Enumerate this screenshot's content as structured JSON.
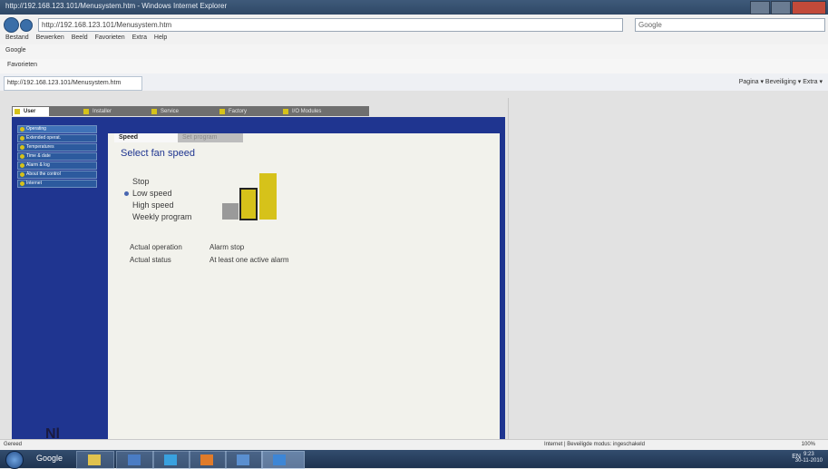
{
  "browser": {
    "window_title": "http://192.168.123.101/Menusystem.htm - Windows Internet Explorer",
    "address": "http://192.168.123.101/Menusystem.htm",
    "search_placeholder": "Google",
    "menu": [
      "Bestand",
      "Bewerken",
      "Beeld",
      "Favorieten",
      "Extra",
      "Help"
    ],
    "google_bar": "Google",
    "favorites_bar": "Favorieten",
    "page_tab": "http://192.168.123.101/Menusystem.htm",
    "page_tools": "Pagina ▾  Beveiliging ▾  Extra ▾",
    "status_left": "Gereed",
    "status_mid": "Internet | Beveiligde modus: ingeschakeld",
    "status_zoom": "100%"
  },
  "app": {
    "tabs": [
      {
        "label": "User",
        "active": true
      },
      {
        "label": "Installer",
        "active": false
      },
      {
        "label": "Service",
        "active": false
      },
      {
        "label": "Factory",
        "active": false
      },
      {
        "label": "I/O Modules",
        "active": false
      }
    ],
    "sidebar": [
      {
        "label": "Operating",
        "active": true
      },
      {
        "label": "Extended operat.",
        "active": false
      },
      {
        "label": "Temperatures",
        "active": false
      },
      {
        "label": "Time & date",
        "active": false
      },
      {
        "label": "Alarm & log",
        "active": false
      },
      {
        "label": "About the control",
        "active": false
      },
      {
        "label": "Internet",
        "active": false
      }
    ],
    "logo": "Nl",
    "panel_tabs": {
      "speed": "Speed",
      "schedule": "Set program"
    },
    "heading": "Select fan speed",
    "fan_options": [
      {
        "label": "Stop",
        "selected": false
      },
      {
        "label": "Low speed",
        "selected": true
      },
      {
        "label": "High speed",
        "selected": false
      },
      {
        "label": "Weekly program",
        "selected": false
      }
    ],
    "fan_level_active": 2,
    "actual_operation_label": "Actual operation",
    "actual_operation_value": "Alarm stop",
    "actual_status_label": "Actual status",
    "actual_status_value": "At least one active alarm"
  },
  "taskbar": {
    "search_label": "Google",
    "tray": "EN",
    "time": "9:23",
    "date": "30-11-2010"
  },
  "colors": {
    "frame_blue": "#1f3590",
    "accent_yellow": "#d6c21a",
    "heading_blue": "#1f3590"
  }
}
